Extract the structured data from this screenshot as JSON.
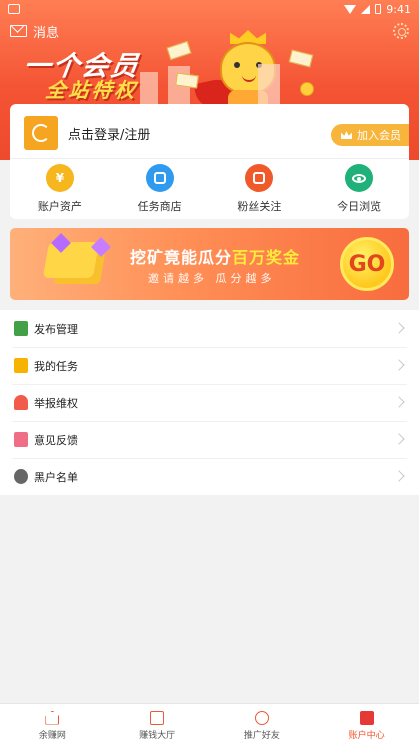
{
  "status_bar": {
    "time": "9:41"
  },
  "header": {
    "message_label": "消息",
    "banner_line1": "一个会员",
    "banner_line2": "全站特权"
  },
  "account_card": {
    "login_text": "点击登录/注册",
    "vip_button": "加入会员",
    "quick_links": [
      {
        "label": "账户资产",
        "icon": "yuan-coin-icon",
        "color": "#f6b61e",
        "glyph": "¥"
      },
      {
        "label": "任务商店",
        "icon": "store-icon",
        "color": "#2e9bf0",
        "glyph": ""
      },
      {
        "label": "粉丝关注",
        "icon": "ticket-icon",
        "color": "#f05a2b",
        "glyph": ""
      },
      {
        "label": "今日浏览",
        "icon": "eye-icon",
        "color": "#20b17a",
        "glyph": ""
      }
    ]
  },
  "promo": {
    "title_main": "挖矿竟能瓜分",
    "title_highlight": "百万奖金",
    "subtitle": "邀请越多 瓜分越多",
    "go_label": "GO"
  },
  "menu": [
    {
      "label": "发布管理",
      "icon": "publish-icon"
    },
    {
      "label": "我的任务",
      "icon": "task-icon"
    },
    {
      "label": "举报维权",
      "icon": "bell-icon"
    },
    {
      "label": "意见反馈",
      "icon": "feedback-icon"
    },
    {
      "label": "黑户名单",
      "icon": "blacklist-icon"
    }
  ],
  "tabbar": [
    {
      "label": "余赚网",
      "icon": "home-icon",
      "active": false
    },
    {
      "label": "赚钱大厅",
      "icon": "chart-icon",
      "active": false
    },
    {
      "label": "推广好友",
      "icon": "friend-icon",
      "active": false
    },
    {
      "label": "账户中心",
      "icon": "wallet-icon",
      "active": true
    }
  ],
  "colors": {
    "brand": "#f2532f",
    "vip": "#f8b53b"
  }
}
